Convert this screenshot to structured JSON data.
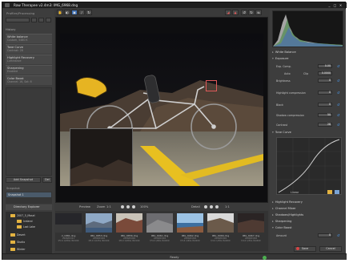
{
  "window": {
    "title": "Raw Therapee v2.4m3: IMG_6968.dng",
    "min": "_",
    "max": "□",
    "close": "✕"
  },
  "left_panel": {
    "title": "Profiles/Processing",
    "history_title": "History",
    "history": [
      {
        "name": "White balance",
        "sub": "Custom, 5480 K"
      },
      {
        "name": "Tone Curve",
        "sub": "Contrast: 28"
      },
      {
        "name": "Highlight Recovery",
        "sub": "Luminance"
      },
      {
        "name": "Sharpening",
        "sub": "Enabled"
      },
      {
        "name": "Color Boost",
        "sub": "Channel: 16, Sat: 6"
      }
    ],
    "add_snapshot": "Add Snapshot",
    "del_snapshot": "Del",
    "snapshot_title": "Snapshot",
    "snapshots": [
      "Snapshot 1"
    ]
  },
  "file_browser": {
    "title": "Directory Explorer",
    "items": [
      {
        "label": "2007_5_Mosel",
        "level": 2
      },
      {
        "label": "Iceland",
        "level": 3
      },
      {
        "label": "Lost Lake",
        "level": 3
      },
      {
        "label": "Desert",
        "level": 2
      },
      {
        "label": "Studio",
        "level": 2
      },
      {
        "label": "Winter",
        "level": 2
      }
    ]
  },
  "image_bar": {
    "preview_label": "Preview",
    "zoom_label": "Zoom",
    "zoom_value": "1:1",
    "detail_label": "Detail",
    "detail_zoom": "100%"
  },
  "filmstrip": [
    {
      "name": "d_1881.dng",
      "sub": "2008/03/21",
      "sub2": "f/5.6 1/250s ISO100",
      "theme": "dark"
    },
    {
      "name": "IMG_6853.dng",
      "sub": "2008/03/08",
      "sub2": "f/8.0 1/125s ISO100",
      "theme": "sky"
    },
    {
      "name": "IMG_6856.dng",
      "sub": "2008/03/08",
      "sub2": "f/8.0 1/200s ISO100",
      "theme": "rock"
    },
    {
      "name": "IMG_6961.dng",
      "sub": "2008/03/08",
      "sub2": "f/5.6 1/60s ISO200",
      "theme": "grey"
    },
    {
      "name": "IMG_6962.dng",
      "sub": "2008/03/08",
      "sub2": "f/5.6 1/60s ISO200",
      "theme": "sea"
    },
    {
      "name": "IMG_6966.dng",
      "sub": "2008/03/08",
      "sub2": "f/4.0 1/30s ISO400",
      "theme": "cliff"
    },
    {
      "name": "IMG_6967.dng",
      "sub": "2008/03/08",
      "sub2": "f/4.0 1/30s ISO400",
      "theme": "night"
    }
  ],
  "right_panel": {
    "sections": {
      "white_balance": "White Balance",
      "exposure": "Exposure",
      "tone_curve": "Tone Curve",
      "highlight": "Highlight Recovery",
      "channel_mixer": "Channel Mixer",
      "shadows": "Shadows/Highlights",
      "sharpening": "Sharpening",
      "color_boost": "Color Boost"
    },
    "exposure_params": [
      {
        "label": "Exp. Comp.",
        "value": "0.00"
      },
      {
        "label": "Auto Levels",
        "value": "0.0000"
      },
      {
        "label": "Brightness",
        "value": "0"
      },
      {
        "label": "Highlight compression",
        "value": "0"
      },
      {
        "label": "Black",
        "value": "0"
      },
      {
        "label": "Shadow compression",
        "value": "50"
      },
      {
        "label": "Contrast",
        "value": "28"
      }
    ],
    "auto_label": "Auto",
    "clip_label": "Clip",
    "linear_label": "Linear",
    "color_boost_param": {
      "label": "Amount",
      "value": "0"
    },
    "save_btn": "Save",
    "cancel_btn": "Cancel"
  },
  "status": {
    "text": "Ready"
  },
  "colors": {
    "accent": "#4da3ff",
    "detail_frame": "#e05a5a",
    "folder": "#e3b341"
  }
}
